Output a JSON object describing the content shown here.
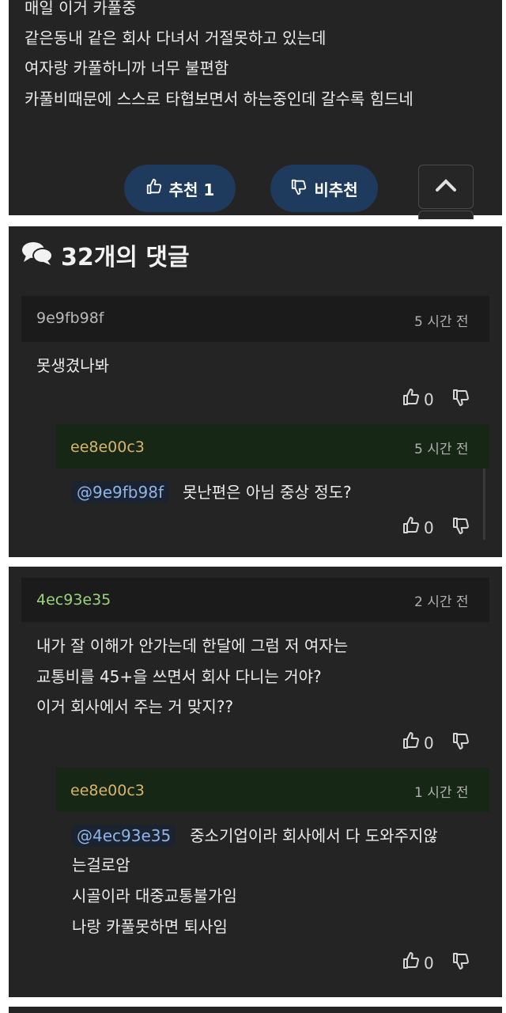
{
  "post": {
    "lines": [
      "매일 이거 카풀중",
      "같은동내 같은 회사 다녀서 거절못하고 있는데",
      "여자랑 카풀하니까 너무 불편함",
      "카풀비때문에 스스로 타협보면서 하는중인데 갈수록 힘드네"
    ],
    "recommend_label": "추천 1",
    "unrecommend_label": "비추천"
  },
  "comments_header": {
    "count_label": "32개의 댓글"
  },
  "comments": [
    {
      "author": "9e9fb98f",
      "time": "5 시간 전",
      "lines": [
        "못생겼나봐"
      ],
      "likes": "0",
      "replies": [
        {
          "author": "ee8e00c3",
          "time": "5 시간 전",
          "mention": "@9e9fb98f",
          "lines": [
            "못난편은 아님 중상 정도?"
          ],
          "likes": "0"
        }
      ]
    },
    {
      "author": "4ec93e35",
      "time": "2 시간 전",
      "lines": [
        "내가 잘 이해가 안가는데 한달에 그럼 저 여자는",
        "교통비를 45+을 쓰면서 회사 다니는 거야?",
        "이거 회사에서 주는 거 맞지??"
      ],
      "likes": "0",
      "replies": [
        {
          "author": "ee8e00c3",
          "time": "1 시간 전",
          "mention": "@4ec93e35",
          "lines": [
            "중소기업이라 회사에서 다 도와주지않",
            "는걸로암",
            "시골이라 대중교통불가임",
            "나랑 카풀못하면 퇴사임"
          ],
          "likes": "0"
        }
      ]
    }
  ]
}
